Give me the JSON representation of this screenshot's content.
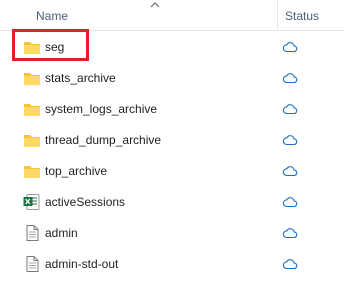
{
  "header": {
    "name_label": "Name",
    "status_label": "Status"
  },
  "files": [
    {
      "name": "seg",
      "type": "folder",
      "status_icon": "cloud-icon"
    },
    {
      "name": "stats_archive",
      "type": "folder",
      "status_icon": "cloud-icon"
    },
    {
      "name": "system_logs_archive",
      "type": "folder",
      "status_icon": "cloud-icon"
    },
    {
      "name": "thread_dump_archive",
      "type": "folder",
      "status_icon": "cloud-icon"
    },
    {
      "name": "top_archive",
      "type": "folder",
      "status_icon": "cloud-icon"
    },
    {
      "name": "activeSessions",
      "type": "excel-file",
      "status_icon": "cloud-icon"
    },
    {
      "name": "admin",
      "type": "text-file",
      "status_icon": "cloud-icon"
    },
    {
      "name": "admin-std-out",
      "type": "text-file",
      "status_icon": "cloud-icon"
    }
  ],
  "colors": {
    "highlight": "#e51e25",
    "folder": "#f8c33a",
    "cloud": "#1f6fbf",
    "excel": "#1f7244"
  }
}
